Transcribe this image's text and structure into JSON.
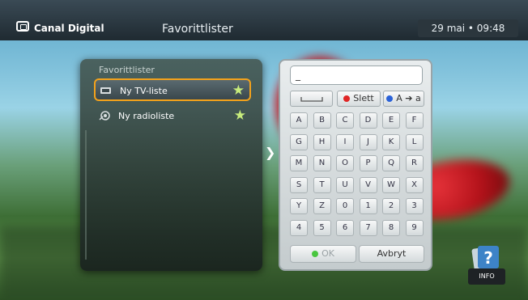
{
  "header": {
    "brand": "Canal Digital",
    "title": "Favorittlister",
    "datetime": "29 mai • 09:48"
  },
  "panel": {
    "title": "Favorittlister",
    "items": [
      {
        "label": "Ny TV-liste",
        "icon": "tv-icon",
        "selected": true
      },
      {
        "label": "Ny radioliste",
        "icon": "radio-icon",
        "selected": false
      }
    ]
  },
  "keyboard": {
    "input_value": "_",
    "delete_label": "Slett",
    "case_label": "A ➔ a",
    "rows": [
      [
        "A",
        "B",
        "C",
        "D",
        "E",
        "F"
      ],
      [
        "G",
        "H",
        "I",
        "J",
        "K",
        "L"
      ],
      [
        "M",
        "N",
        "O",
        "P",
        "Q",
        "R"
      ],
      [
        "S",
        "T",
        "U",
        "V",
        "W",
        "X"
      ],
      [
        "Y",
        "Z",
        "0",
        "1",
        "2",
        "3"
      ],
      [
        "4",
        "5",
        "6",
        "7",
        "8",
        "9"
      ]
    ],
    "ok_label": "OK",
    "cancel_label": "Avbryt"
  },
  "info_label": "INFO",
  "colors": {
    "accent": "#f3a21b",
    "star": "#c7ec7c",
    "red_key": "#e02525",
    "blue_key": "#2a62d8",
    "green_key": "#49c63f"
  }
}
